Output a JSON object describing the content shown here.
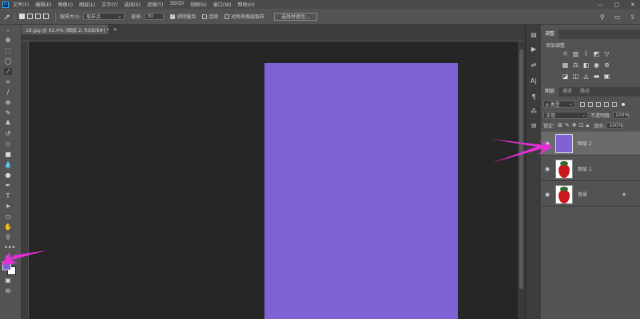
{
  "app": {
    "logo_text": "Ps"
  },
  "menubar": {
    "items": [
      "文件(F)",
      "编辑(E)",
      "图像(I)",
      "图层(L)",
      "文字(Y)",
      "选择(S)",
      "滤镜(T)",
      "3D(D)",
      "视图(V)",
      "窗口(W)",
      "帮助(H)"
    ],
    "window_controls": [
      "—",
      "□",
      "✕"
    ]
  },
  "options": {
    "sample_size_label": "取样大小:",
    "sample_size_value": "取样点",
    "tolerance_label": "容差:",
    "tolerance_value": "30",
    "antialias_label": "消除锯齿",
    "antialias_checked": true,
    "contiguous_label": "连续",
    "contiguous_checked": false,
    "all_layers_label": "对所有图层取样",
    "all_layers_checked": false,
    "select_subject_label": "选择并遮住...",
    "right_icons": [
      "search-icon",
      "workspace-icon",
      "share-icon"
    ]
  },
  "document": {
    "tab_title": "18.jpg @ 92.4% (图层 2, RGB/8#) *",
    "tab_close": "×",
    "canvas_color": "#7f62d3"
  },
  "panels": {
    "adjustments": {
      "tab": "调整",
      "title": "添加调整"
    },
    "layers": {
      "tabs": [
        "图层",
        "通道",
        "路径"
      ],
      "filter_label": "ρ 类型",
      "blend_mode": "正常",
      "opacity_label": "不透明度:",
      "opacity_value": "100%",
      "lock_label": "锁定:",
      "fill_label": "填充:",
      "fill_value": "100%",
      "items": [
        {
          "name": "图层 2",
          "thumb": "purple",
          "selected": true,
          "locked": false
        },
        {
          "name": "图层 1",
          "thumb": "strawberry",
          "selected": false,
          "locked": false
        },
        {
          "name": "背景",
          "thumb": "strawberry",
          "selected": false,
          "locked": true
        }
      ]
    }
  },
  "colors": {
    "foreground": "#7f62d3",
    "background": "#ffffff",
    "annotation_arrow": "#e62ed8"
  }
}
